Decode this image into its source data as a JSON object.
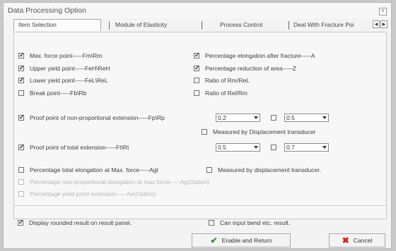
{
  "window": {
    "title": "Data Processing Option",
    "close_label": "x"
  },
  "tabs": [
    {
      "label": "Item Selection"
    },
    {
      "label": "Module of Elasticity"
    },
    {
      "label": "Process Control"
    },
    {
      "label": "Deal With Fracture Poi"
    }
  ],
  "tab_scroll": {
    "left": "◀",
    "right": "▶"
  },
  "items": {
    "max_force": {
      "label": "Max. force point-----Fm\\Rm",
      "checked": true
    },
    "pct_elong_fracture": {
      "label": "Percentage elongation after fracture-----A",
      "checked": true
    },
    "upper_yield": {
      "label": "Upper yield point-----FeH\\ReH",
      "checked": true
    },
    "pct_reduction": {
      "label": "Percentage reduction of area-----Z",
      "checked": true
    },
    "lower_yield": {
      "label": "Lower yield point-----FeL\\ReL",
      "checked": true
    },
    "ratio_rm_rel": {
      "label": "Ratio of Rm/ReL",
      "checked": false
    },
    "break_point": {
      "label": "Break point-----Fb\\Rb",
      "checked": false
    },
    "ratio_rel_rm": {
      "label": "Ratio of Rel/Rm",
      "checked": false
    },
    "proof_nonprop": {
      "label": "Proof point of non-proportional extension-----Fp\\Rp",
      "checked": true,
      "value1": "0.2",
      "checked2": false,
      "value2": "0.5"
    },
    "measured_disp_1": {
      "label": "Measured by Displacement transducer",
      "checked": false
    },
    "proof_total": {
      "label": "Proof point of total extension-----Ft\\Rt",
      "checked": true,
      "value1": "0.5",
      "checked2": false,
      "value2": "0.7"
    },
    "pct_total_elong": {
      "label": "Percentage total elongation at Max. force-----Agt",
      "checked": false
    },
    "measured_disp_2": {
      "label": "Measured by displacement transducer.",
      "checked": false
    },
    "pct_nonprop_elong": {
      "label": "Percentage non-proportional elongation at max force-----Ag(Option)",
      "checked": false,
      "disabled": true
    },
    "pct_yield_ext": {
      "label": "Percentage yield point extension-----Ae(Option)",
      "checked": false,
      "disabled": true
    }
  },
  "bottom": {
    "display_rounded": {
      "label": "Display rounded result on result panel.",
      "checked": true
    },
    "can_input_bend": {
      "label": "Can input bend etc. result.",
      "checked": false
    }
  },
  "buttons": {
    "enable_return": {
      "label": "Enable and Return",
      "icon": "check-icon"
    },
    "cancel": {
      "label": "Cancel",
      "icon": "x-icon"
    }
  }
}
